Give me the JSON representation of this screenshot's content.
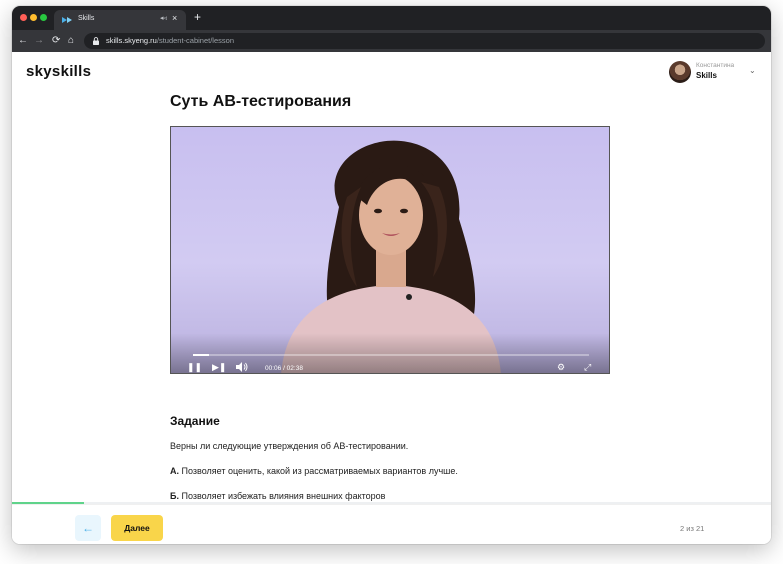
{
  "browser": {
    "tab_title": "Skills",
    "new_tab_label": "+",
    "tab_close_label": "×",
    "url_host": "skills.skyeng.ru",
    "url_path": "/student-cabinet/lesson",
    "nav_back": "←",
    "nav_forward": "→",
    "nav_reload": "⟳",
    "nav_home": "⌂"
  },
  "header": {
    "logo": "skyskills",
    "profile_name": "Константина",
    "profile_sub": "Skills",
    "profile_chevron": "⌄"
  },
  "lesson": {
    "title": "Суть АВ-тестирования"
  },
  "video": {
    "current_time": "00:06",
    "duration": "02:38",
    "time_display": "00:06 / 02:38",
    "progress_fraction": 0.04,
    "play_icon": "❚❚",
    "next_icon": "▶❚",
    "volume_icon": "🔊",
    "settings_icon": "⚙",
    "fullscreen_icon": "⤢"
  },
  "task": {
    "heading": "Задание",
    "question": "Верны ли следующие утверждения об АВ-тестировании.",
    "items": [
      {
        "letter": "А.",
        "text": "Позволяет оценить, какой из рассматриваемых вариантов лучше."
      },
      {
        "letter": "Б.",
        "text": "Позволяет избежать влияния внешних факторов"
      }
    ]
  },
  "footer": {
    "back_icon": "←",
    "next_label": "Далее",
    "page_counter": "2 из 21",
    "lesson_progress_fraction": 0.095
  },
  "colors": {
    "accent_yellow": "#f9d54a",
    "accent_blue": "#4ab0e8",
    "progress_green": "#5fd38a"
  }
}
